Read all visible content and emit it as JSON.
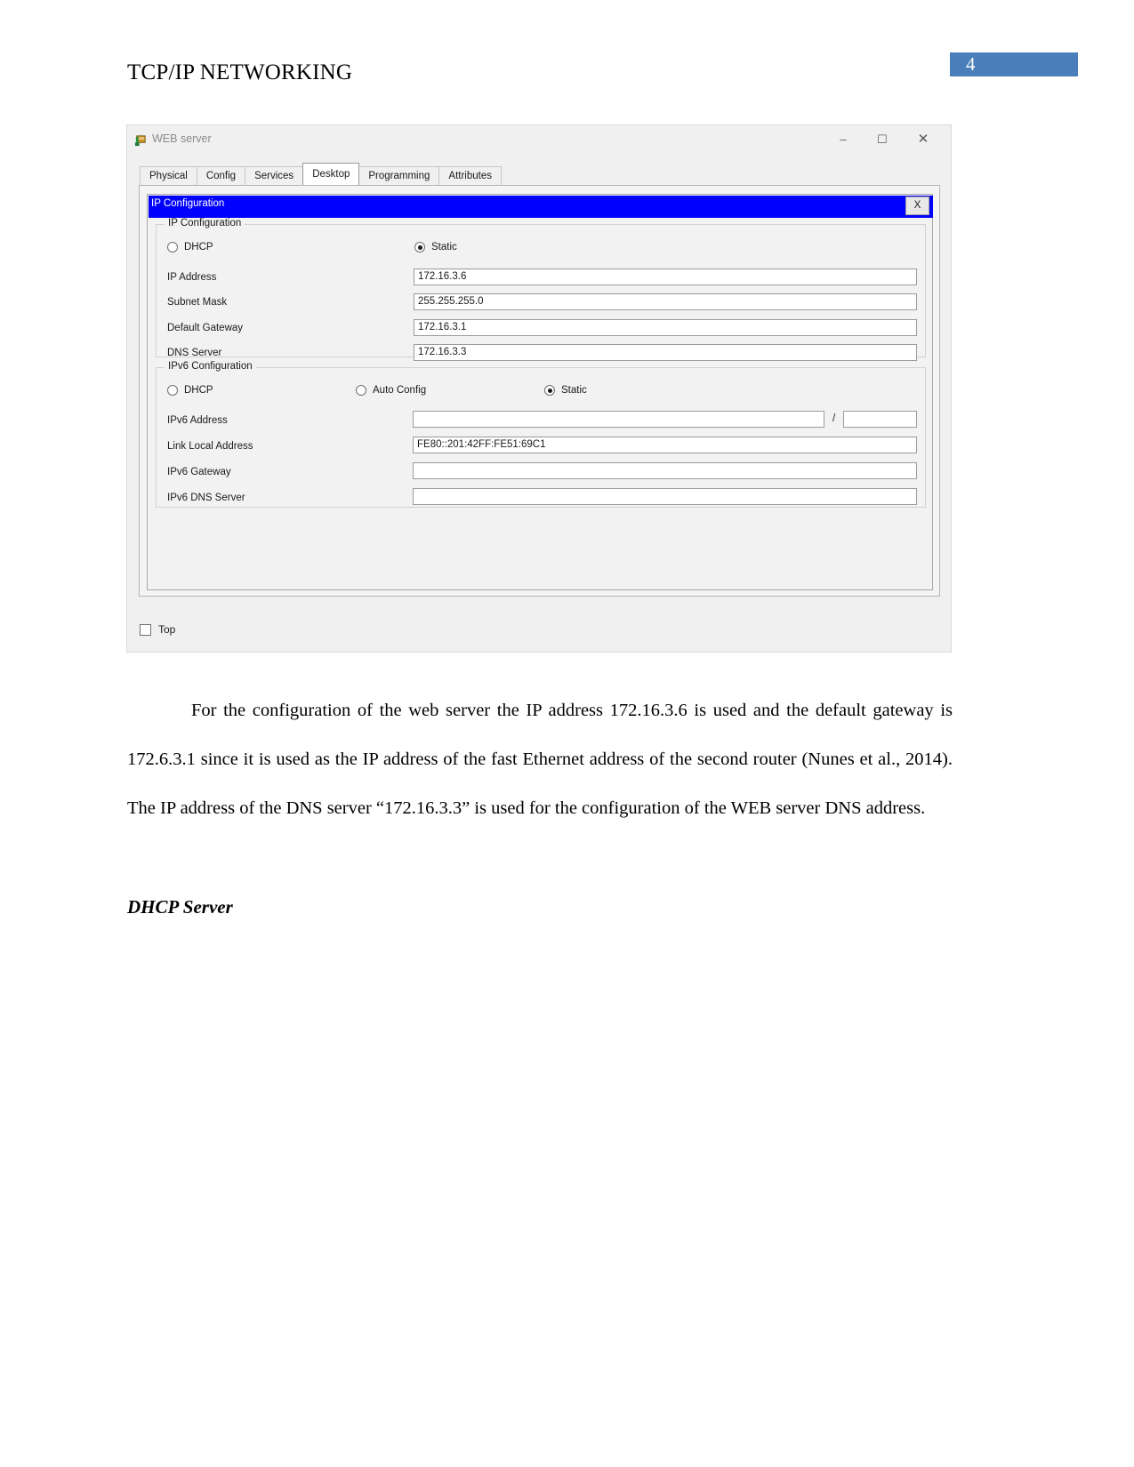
{
  "document": {
    "header_title": "TCP/IP NETWORKING",
    "page_number": "4",
    "accent_color": "#4a7ebb",
    "paragraph": "For the configuration of the web server the IP address 172.16.3.6 is used and the default gateway is 172.6.3.1 since it is used as the IP address of the fast Ethernet address of the second router (Nunes et al.,  2014). The IP address of the DNS server “172.16.3.3” is used for the configuration of the WEB server DNS address.",
    "section_heading": "DHCP Server"
  },
  "window": {
    "title": "WEB server",
    "icon": "packet-tracer-device-icon",
    "controls": {
      "minimize": "–",
      "maximize": "☐",
      "close": "✕"
    },
    "tabs": [
      {
        "label": "Physical",
        "active": false
      },
      {
        "label": "Config",
        "active": false
      },
      {
        "label": "Services",
        "active": false
      },
      {
        "label": "Desktop",
        "active": true
      },
      {
        "label": "Programming",
        "active": false
      },
      {
        "label": "Attributes",
        "active": false
      }
    ]
  },
  "ip_config_window": {
    "title": "IP Configuration",
    "close_label": "X",
    "titlebar_color": "#0000ff",
    "ipv4": {
      "legend": "IP Configuration",
      "mode_options": [
        {
          "label": "DHCP",
          "selected": false
        },
        {
          "label": "Static",
          "selected": true
        }
      ],
      "fields": [
        {
          "label": "IP Address",
          "value": "172.16.3.6"
        },
        {
          "label": "Subnet Mask",
          "value": "255.255.255.0"
        },
        {
          "label": "Default Gateway",
          "value": "172.16.3.1"
        },
        {
          "label": "DNS Server",
          "value": "172.16.3.3"
        }
      ]
    },
    "ipv6": {
      "legend": "IPv6 Configuration",
      "mode_options": [
        {
          "label": "DHCP",
          "selected": false
        },
        {
          "label": "Auto Config",
          "selected": false
        },
        {
          "label": "Static",
          "selected": true
        }
      ],
      "prefix_separator": "/",
      "fields": [
        {
          "label": "IPv6 Address",
          "value": ""
        },
        {
          "label": "Link Local Address",
          "value": "FE80::201:42FF:FE51:69C1"
        },
        {
          "label": "IPv6 Gateway",
          "value": ""
        },
        {
          "label": "IPv6 DNS Server",
          "value": ""
        }
      ],
      "prefix_value": ""
    }
  },
  "bottom_bar": {
    "top_checkbox_label": "Top",
    "top_checkbox_checked": false
  }
}
